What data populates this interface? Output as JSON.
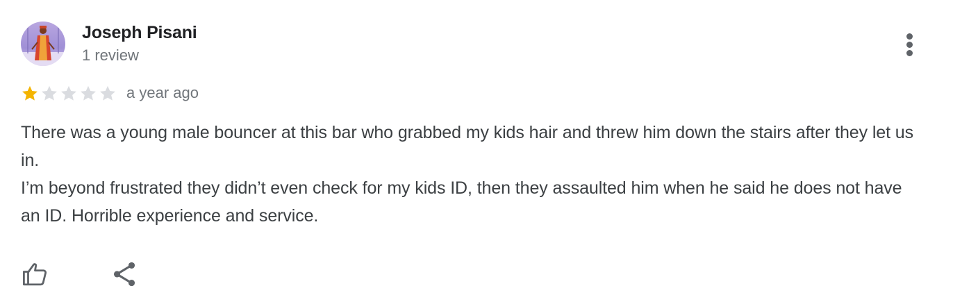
{
  "review": {
    "reviewer_name": "Joseph Pisani",
    "review_count": "1 review",
    "rating": 1,
    "max_rating": 5,
    "date": "a year ago",
    "text_paragraphs": [
      "There was a young male bouncer at this bar who grabbed my kids hair and threw him down the stairs after they let us in.",
      "I’m beyond frustrated they didn’t even check for my kids ID, then they assaulted him when he said he does not have an ID. Horrible experience and service."
    ]
  },
  "icons": {
    "avatar": "avatar-photo",
    "more": "more-vert-icon",
    "like": "thumb-up-icon",
    "share": "share-icon",
    "star_filled": "star-filled-icon",
    "star_empty": "star-empty-icon"
  },
  "colors": {
    "star_filled": "#f4b400",
    "star_empty": "#dadce0",
    "text_primary": "#202124",
    "text_secondary": "#70757a",
    "icon": "#5f6368"
  }
}
